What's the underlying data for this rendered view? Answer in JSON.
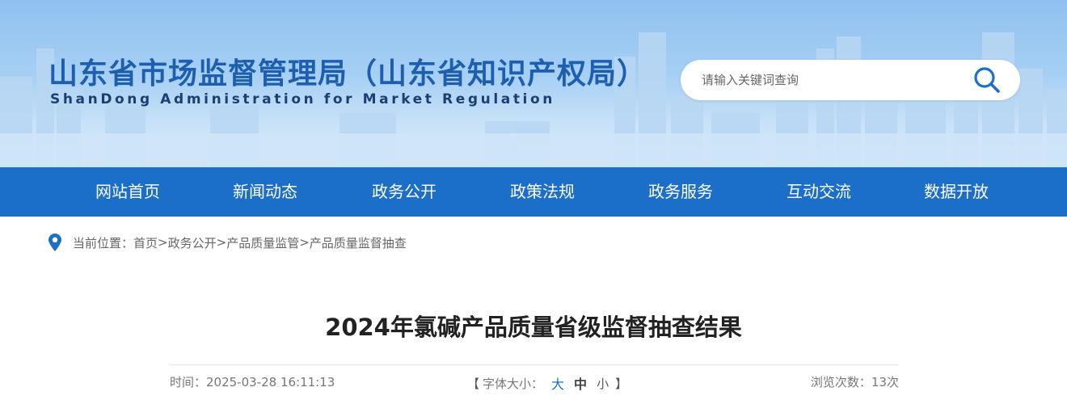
{
  "header": {
    "title": "山东省市场监督管理局（山东省知识产权局）",
    "subtitle": "ShanDong Administration for Market Regulation"
  },
  "search": {
    "placeholder": "请输入关键词查询",
    "icon": "search-icon"
  },
  "nav": {
    "items": [
      {
        "label": "网站首页"
      },
      {
        "label": "新闻动态"
      },
      {
        "label": "政务公开"
      },
      {
        "label": "政策法规"
      },
      {
        "label": "政务服务"
      },
      {
        "label": "互动交流"
      },
      {
        "label": "数据开放"
      }
    ]
  },
  "breadcrumb": {
    "prefix": "当前位置：",
    "items": [
      "首页",
      "政务公开",
      "产品质量监管",
      "产品质量监督抽查"
    ],
    "separator": ">"
  },
  "article": {
    "title": "2024年氯碱产品质量省级监督抽查结果",
    "time_label": "时间：2025-03-28 16:11:13",
    "font_size_label": "字体大小：",
    "font_options": [
      "大",
      "中",
      "小"
    ],
    "views_label": "浏览次数：13次"
  },
  "colors": {
    "nav_bg": "#1c6fc9",
    "title_blue": "#1d5fae",
    "accent": "#1c6fc9"
  }
}
